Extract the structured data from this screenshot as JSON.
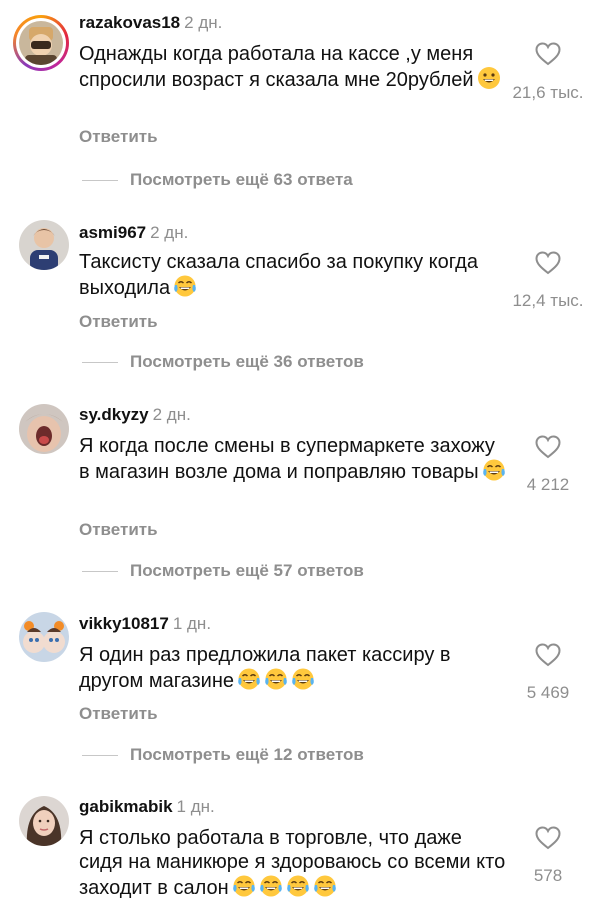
{
  "comments": [
    {
      "username": "razakovas18",
      "time": "2 дн.",
      "text": "Однажды когда работала на кассе ,у меня спросили возраст я сказала мне 20рублей",
      "emojis": [
        "grinning-face"
      ],
      "reply_label": "Ответить",
      "more_replies": "Посмотреть ещё 63 ответа",
      "likes": "21,6 тыс.",
      "has_story": true
    },
    {
      "username": "asmi967",
      "time": "2 дн.",
      "text": "Таксисту сказала спасибо за покупку когда выходила",
      "emojis": [
        "tears-of-joy"
      ],
      "reply_label": "Ответить",
      "more_replies": "Посмотреть ещё 36 ответов",
      "likes": "12,4 тыс.",
      "has_story": false
    },
    {
      "username": "sy.dkyzy",
      "time": "2 дн.",
      "text": "Я когда после смены в супермаркете захожу в магазин возле дома и поправляю товары",
      "emojis": [
        "tears-of-joy"
      ],
      "reply_label": "Ответить",
      "more_replies": "Посмотреть ещё 57 ответов",
      "likes": "4 212",
      "has_story": false
    },
    {
      "username": "vikky10817",
      "time": "1 дн.",
      "text": "Я один раз предложила пакет кассиру в другом магазине",
      "emojis": [
        "tears-of-joy",
        "tears-of-joy",
        "tears-of-joy"
      ],
      "reply_label": "Ответить",
      "more_replies": "Посмотреть ещё 12 ответов",
      "likes": "5 469",
      "has_story": false
    },
    {
      "username": "gabikmabik",
      "time": "1 дн.",
      "text": "Я столько работала в торговле, что даже сидя на маникюре я здороваюсь со всеми кто заходит в салон",
      "emojis": [
        "tears-of-joy",
        "tears-of-joy",
        "tears-of-joy",
        "tears-of-joy"
      ],
      "likes": "578",
      "has_story": false
    }
  ],
  "icons": {
    "like": "heart-outline-icon"
  },
  "colors": {
    "text": "#111111",
    "secondary": "#8e8e8e",
    "divider": "#c7c7c7"
  }
}
